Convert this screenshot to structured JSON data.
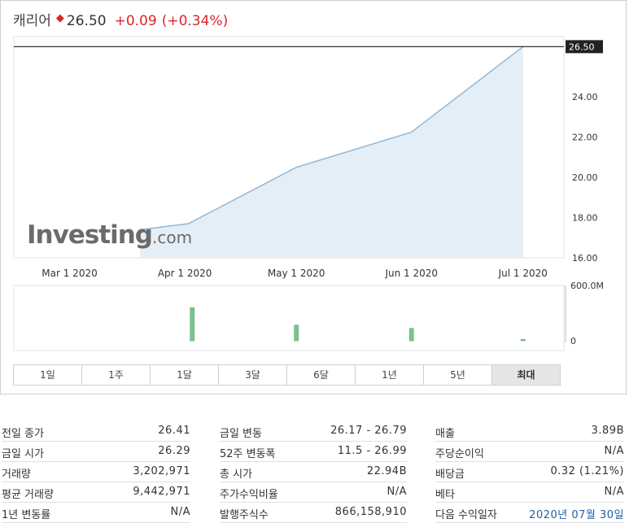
{
  "header": {
    "name": "캐리어",
    "price": "26.50",
    "change": "+0.09",
    "change_pct": "(+0.34%)"
  },
  "colors": {
    "up": "#d9262c",
    "line": "#8fb9d8",
    "area_fill": "#e4eef6",
    "volume": "#7cc48f",
    "link": "#1f5fa8"
  },
  "watermark": {
    "main": "Investing",
    "suffix": ".com"
  },
  "chart_data": {
    "type": "area",
    "x": [
      "2020-03-20",
      "2020-04-02",
      "2020-05-01",
      "2020-06-01",
      "2020-07-01"
    ],
    "y": [
      17.4,
      17.7,
      20.5,
      22.25,
      26.5
    ],
    "last_value_label": "26.50",
    "ylim": [
      16,
      27
    ],
    "y_ticks": [
      16,
      18,
      20,
      22,
      24
    ],
    "y_tick_labels": [
      "16.00",
      "18.00",
      "20.00",
      "22.00",
      "24.00"
    ],
    "x_ticks": [
      "2020-03-01",
      "2020-04-01",
      "2020-05-01",
      "2020-06-01",
      "2020-07-01"
    ],
    "x_tick_labels": [
      "Mar 1 2020",
      "Apr 1 2020",
      "May 1 2020",
      "Jun 1 2020",
      "Jul 1 2020"
    ],
    "volume": {
      "type": "bar",
      "x": [
        "2020-04-03",
        "2020-05-01",
        "2020-06-01",
        "2020-07-01"
      ],
      "values": [
        360,
        170,
        135,
        15
      ],
      "unit": "M",
      "ylim": [
        0,
        600
      ],
      "tick_labels": [
        "600.0M",
        "0"
      ]
    }
  },
  "periods": [
    "1일",
    "1주",
    "1달",
    "3달",
    "6달",
    "1년",
    "5년",
    "최대"
  ],
  "active_period": "최대",
  "stats": {
    "col1": [
      {
        "label": "전일 종가",
        "value": "26.41"
      },
      {
        "label": "금일 시가",
        "value": "26.29"
      },
      {
        "label": "거래량",
        "value": "3,202,971"
      },
      {
        "label": "평균 거래량",
        "value": "9,442,971"
      },
      {
        "label": "1년 변동률",
        "value": "N/A"
      }
    ],
    "col2": [
      {
        "label": "금일 변동",
        "value": "26.17 - 26.79"
      },
      {
        "label": "52주 변동폭",
        "value": "11.5 - 26.99"
      },
      {
        "label": "총 시가",
        "value": "22.94B"
      },
      {
        "label": "주가수익비율",
        "value": "N/A"
      },
      {
        "label": "발행주식수",
        "value": "866,158,910"
      }
    ],
    "col3": [
      {
        "label": "매출",
        "value": "3.89B"
      },
      {
        "label": "주당순이익",
        "value": "N/A"
      },
      {
        "label": "배당금",
        "value": "0.32 (1.21%)"
      },
      {
        "label": "베타",
        "value": "N/A"
      },
      {
        "label": "다음 수익일자",
        "value": "2020년 07월 30일"
      }
    ]
  }
}
